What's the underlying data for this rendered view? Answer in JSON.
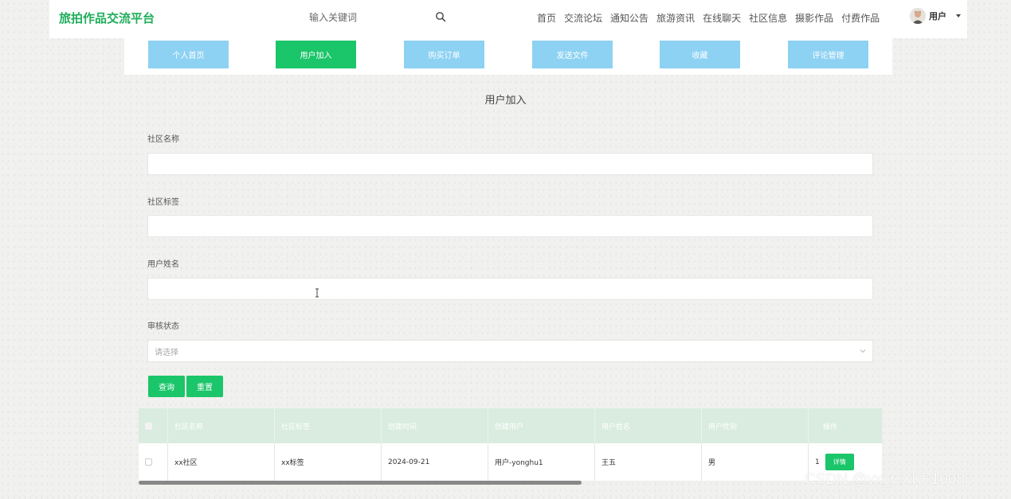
{
  "app": {
    "title": "旅拍作品交流平台",
    "accent_color": "#1bc56a",
    "tab_color": "#8ed2f3"
  },
  "search": {
    "placeholder": "输入关键词",
    "icon": "search-icon"
  },
  "nav": {
    "items": [
      "首页",
      "交流论坛",
      "通知公告",
      "旅游资讯",
      "在线聊天",
      "社区信息",
      "摄影作品",
      "付费作品"
    ]
  },
  "user": {
    "name": "用户",
    "icon": "avatar"
  },
  "tabs": [
    {
      "label": "个人首页",
      "active": false
    },
    {
      "label": "用户加入",
      "active": true
    },
    {
      "label": "购买订单",
      "active": false
    },
    {
      "label": "发送文件",
      "active": false
    },
    {
      "label": "收藏",
      "active": false
    },
    {
      "label": "评论管理",
      "active": false
    }
  ],
  "page": {
    "title": "用户加入"
  },
  "form": {
    "community_name_label": "社区名称",
    "community_tag_label": "社区标签",
    "user_name_label": "用户姓名",
    "review_status_label": "审核状态",
    "review_status_placeholder": "请选择",
    "query_button": "查询",
    "reset_button": "重置"
  },
  "table": {
    "headers": [
      "社区名称",
      "社区标签",
      "创建时间",
      "创建用户",
      "用户姓名",
      "用户性别",
      "操作"
    ],
    "rows": [
      {
        "community_name": "xx社区",
        "community_tag": "xx标签",
        "created_time": "2024-09-21",
        "creator": "用户-yonghu1",
        "user_name": "王五",
        "user_gender": "男",
        "index": "1",
        "action": "详情"
      }
    ]
  },
  "watermark": "CSDN @vx_CXKF10088"
}
